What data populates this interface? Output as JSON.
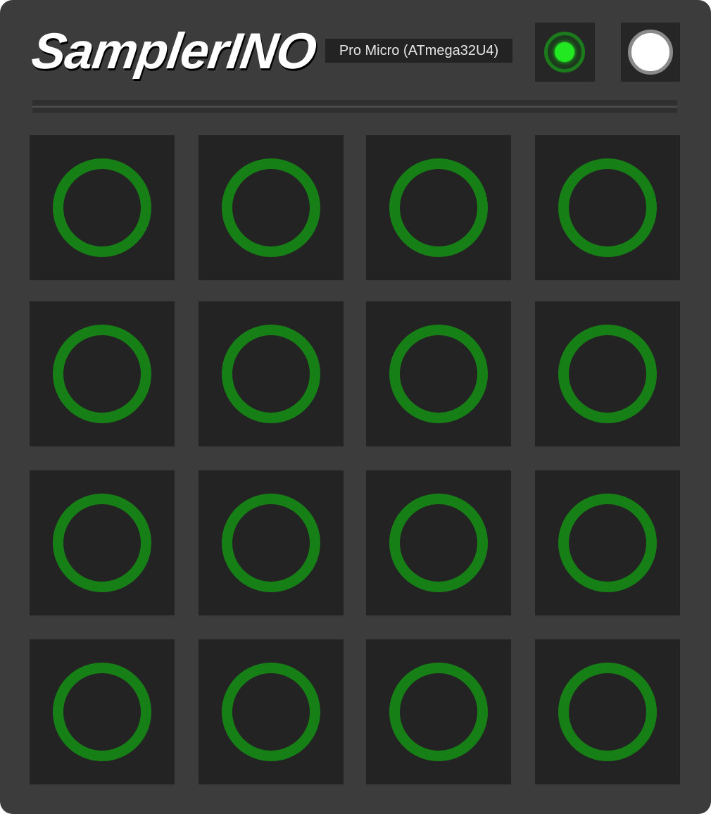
{
  "app": {
    "title": "SamplerINO",
    "board_selected": "Pro Micro (ATmega32U4)"
  },
  "status": {
    "led_icon": "status-led-icon",
    "led_state": "on",
    "led_color": "#22e822"
  },
  "controls": {
    "button_icon": "round-button-icon"
  },
  "pads": {
    "rows": 4,
    "columns": 4,
    "ring_color": "#168016",
    "count": 16
  },
  "colors": {
    "background": "#3c3c3c",
    "pad": "#232323",
    "accent": "#168016"
  }
}
